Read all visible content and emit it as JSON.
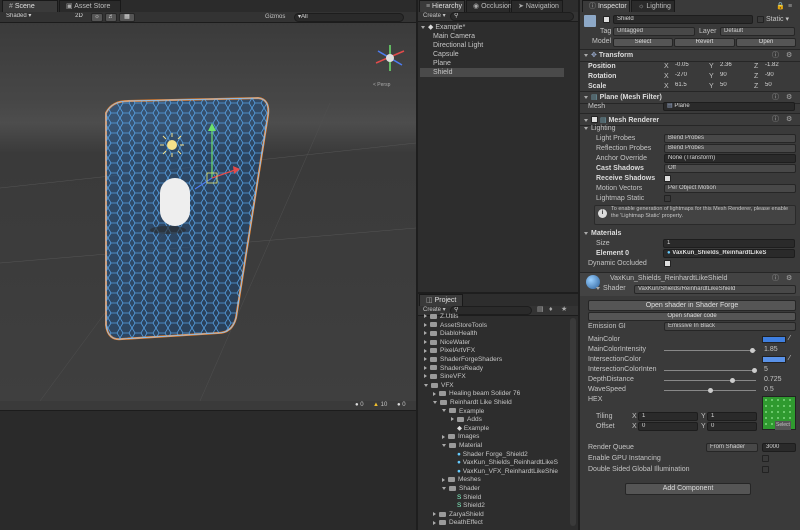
{
  "scene": {
    "tab_scene": "Scene",
    "tab_asset_store": "Asset Store",
    "shading": "Shaded",
    "mode_2d": "2D",
    "gizmos": "Gizmos",
    "search": "▾All",
    "warnings": "0",
    "alerts": "10",
    "errors": "0"
  },
  "hierarchy": {
    "tab": "Hierarchy",
    "tab_occlusion": "Occlusion",
    "tab_navigation": "Navigation",
    "create": "Create",
    "scene_name": "Example*",
    "items": [
      "Main Camera",
      "Directional Light",
      "Capsule",
      "Plane",
      "Shield"
    ]
  },
  "project": {
    "tab": "Project",
    "create": "Create",
    "items": [
      {
        "label": "Z.Utils",
        "depth": 0,
        "type": "folder"
      },
      {
        "label": "AssetStoreTools",
        "depth": 0,
        "type": "folder"
      },
      {
        "label": "DiabloHealth",
        "depth": 0,
        "type": "folder"
      },
      {
        "label": "NiceWater",
        "depth": 0,
        "type": "folder"
      },
      {
        "label": "PixelArtVFX",
        "depth": 0,
        "type": "folder"
      },
      {
        "label": "ShaderForgeShaders",
        "depth": 0,
        "type": "folder"
      },
      {
        "label": "ShadersReady",
        "depth": 0,
        "type": "folder"
      },
      {
        "label": "SineVFX",
        "depth": 0,
        "type": "folder"
      },
      {
        "label": "VFX",
        "depth": 0,
        "type": "folder-open"
      },
      {
        "label": "Healing beam Solider 76",
        "depth": 1,
        "type": "folder"
      },
      {
        "label": "Reinhardt Like Shield",
        "depth": 1,
        "type": "folder-open"
      },
      {
        "label": "Example",
        "depth": 2,
        "type": "folder-open"
      },
      {
        "label": "Adds",
        "depth": 3,
        "type": "folder"
      },
      {
        "label": "Example",
        "depth": 3,
        "type": "unity"
      },
      {
        "label": "Images",
        "depth": 2,
        "type": "folder"
      },
      {
        "label": "Material",
        "depth": 2,
        "type": "folder-open"
      },
      {
        "label": "Shader Forge_Shield2",
        "depth": 3,
        "type": "material"
      },
      {
        "label": "VaxKun_Shields_ReinhardtLikeS",
        "depth": 3,
        "type": "material"
      },
      {
        "label": "VaxKun_VFX_ReinhardtLikeShie",
        "depth": 3,
        "type": "material"
      },
      {
        "label": "Meshes",
        "depth": 2,
        "type": "folder"
      },
      {
        "label": "Shader",
        "depth": 2,
        "type": "folder-open"
      },
      {
        "label": "Shield",
        "depth": 3,
        "type": "shader"
      },
      {
        "label": "Shield2",
        "depth": 3,
        "type": "shader"
      },
      {
        "label": "ZaryaShield",
        "depth": 1,
        "type": "folder"
      },
      {
        "label": "DeathEffect",
        "depth": 1,
        "type": "folder"
      }
    ]
  },
  "inspector": {
    "tab": "Inspector",
    "tab_lighting": "Lighting",
    "object_name": "Shield",
    "static": "Static",
    "tag_label": "Tag",
    "tag_value": "Untagged",
    "layer_label": "Layer",
    "layer_value": "Default",
    "model_label": "Model",
    "select": "Select",
    "revert": "Revert",
    "open": "Open",
    "transform": {
      "title": "Transform",
      "position": "Position",
      "rotation": "Rotation",
      "scale": "Scale",
      "px": "-0.05",
      "py": "2.36",
      "pz": "-1.82",
      "rx": "-270",
      "ry": "90",
      "rz": "-90",
      "sx": "61.5",
      "sy": "50",
      "sz": "50",
      "x": "X",
      "y": "Y",
      "z": "Z"
    },
    "mesh_filter": {
      "title": "Plane (Mesh Filter)",
      "mesh_label": "Mesh",
      "mesh_value": "Plane"
    },
    "mesh_renderer": {
      "title": "Mesh Renderer",
      "lighting": "Lighting",
      "light_probes": "Light Probes",
      "light_probes_v": "Blend Probes",
      "reflection_probes": "Reflection Probes",
      "reflection_probes_v": "Blend Probes",
      "anchor_override": "Anchor Override",
      "anchor_override_v": "None (Transform)",
      "cast_shadows": "Cast Shadows",
      "cast_shadows_v": "Off",
      "receive_shadows": "Receive Shadows",
      "motion_vectors": "Motion Vectors",
      "motion_vectors_v": "Per Object Motion",
      "lightmap_static": "Lightmap Static",
      "info": "To enable generation of lightmaps for this Mesh Renderer, please enable the 'Lightmap Static' property.",
      "materials": "Materials",
      "size_label": "Size",
      "size_value": "1",
      "element0": "Element 0",
      "element0_value": "VaxKun_Shields_ReinhardtLikeS",
      "dynamic_occluded": "Dynamic Occluded"
    },
    "material": {
      "title": "VaxKun_Shields_ReinhardtLikeShield",
      "shader_label": "Shader",
      "shader_value": "VaxKun/Shields/ReinhardtLikeShield",
      "open_sf": "Open shader in Shader Forge",
      "open_code": "Open shader code",
      "emission_gi": "Emission GI",
      "emission_gi_v": "Emissive In Black",
      "main_color": "MainColor",
      "main_color_intensity": "MainColorIntensity",
      "main_color_intensity_v": "1.85",
      "intersection_color": "IntersectionColor",
      "intersection_color_inten": "IntersectionColorInten",
      "intersection_color_inten_v": "5",
      "depth_distance": "DepthDistance",
      "depth_distance_v": "0.725",
      "wave_speed": "WaveSpeed",
      "wave_speed_v": "0.5",
      "hex": "HEX",
      "tiling": "Tiling",
      "offset": "Offset",
      "tx": "1",
      "ty": "1",
      "ox": "0",
      "oy": "0",
      "select": "Select",
      "render_queue": "Render Queue",
      "render_queue_v": "From Shader",
      "render_queue_n": "3000",
      "gpu_instancing": "Enable GPU Instancing",
      "double_sided_gi": "Double Sided Global Illumination",
      "add_component": "Add Component"
    }
  },
  "colors": {
    "accent": "#3d6fb3",
    "shield_blue": "#3fa0ff",
    "outline": "#ff8a2a",
    "main_color": "#3f7fe0",
    "intersection_color": "#5a92e8",
    "hex_tex": "#2f9a2f"
  }
}
